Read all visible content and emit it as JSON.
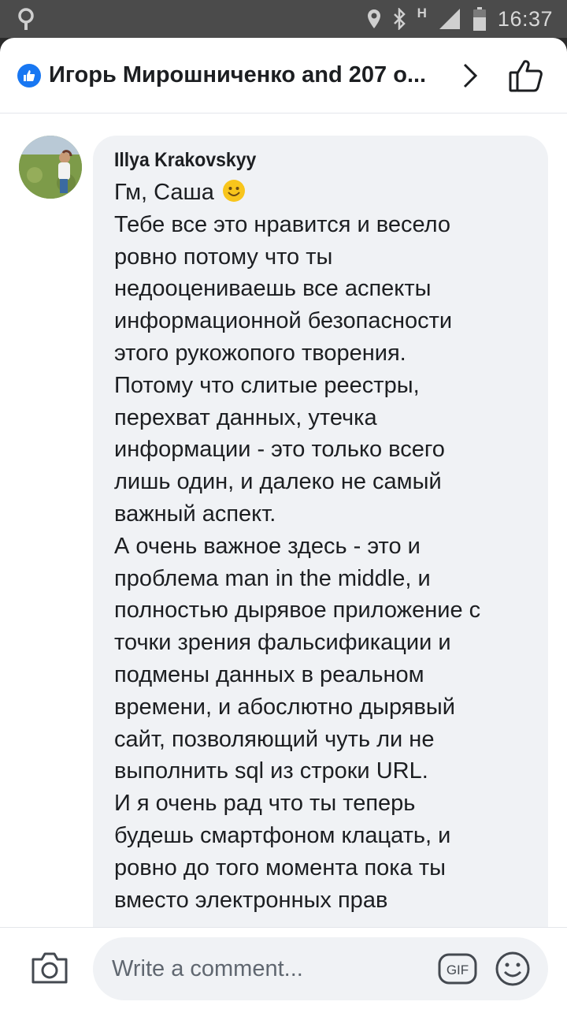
{
  "status_bar": {
    "time": "16:37",
    "network": "H"
  },
  "header": {
    "title": "Игорь Мирошниченко and 207 o..."
  },
  "comment": {
    "author": "Illya Krakovskyy",
    "lines": [
      "Гм, Саша",
      "Тебе все это нравится и весело",
      "ровно потому что ты",
      "недооцениваешь все аспекты",
      "информационной безопасности",
      "этого рукожопого творения.",
      "Потому что слитые реестры,",
      "перехват данных, утечка",
      "информации - это только всего",
      "лишь один, и далеко не самый",
      "важный аспект.",
      "А очень важное здесь - это и",
      "проблема man in the middle, и",
      "полностью дырявое приложение с",
      "точки зрения фальсификации и",
      "подмены данных в реальном",
      "времени, и абослютно дырявый",
      "сайт, позволяющий чуть ли не",
      "выполнить sql из строки URL.",
      "И я очень рад что ты теперь",
      "будешь смартфоном клацать, и",
      "ровно до того момента пока ты",
      "вместо электронных прав"
    ],
    "first_line_emoji": "smiley-emoji"
  },
  "composer": {
    "placeholder": "Write a comment..."
  },
  "colors": {
    "accent": "#1877f2",
    "bubble": "#f0f2f5",
    "status_bar": "#4b4b4b"
  }
}
